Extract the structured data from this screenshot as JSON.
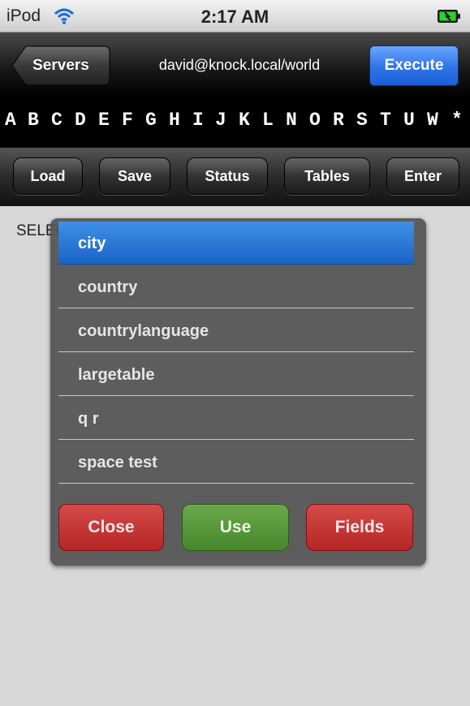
{
  "status_bar": {
    "carrier": "iPod",
    "time": "2:17 AM"
  },
  "nav": {
    "back_label": "Servers",
    "title": "david@knock.local/world",
    "execute_label": "Execute"
  },
  "letters": [
    "A",
    "B",
    "C",
    "D",
    "E",
    "F",
    "G",
    "H",
    "I",
    "J",
    "K",
    "L",
    "N",
    "O",
    "R",
    "S",
    "T",
    "U",
    "W",
    "*"
  ],
  "toolbar": {
    "load": "Load",
    "save": "Save",
    "status": "Status",
    "tables": "Tables",
    "enter": "Enter"
  },
  "editor": {
    "query": "SELECT * FROM city"
  },
  "table_picker": {
    "items": [
      "city",
      "country",
      "countrylanguage",
      "largetable",
      "q r",
      "space test"
    ],
    "selected": "city",
    "close_label": "Close",
    "use_label": "Use",
    "fields_label": "Fields"
  },
  "colors": {
    "accent_blue": "#2f74e8",
    "red_button": "#c23434",
    "green_button": "#569839"
  }
}
